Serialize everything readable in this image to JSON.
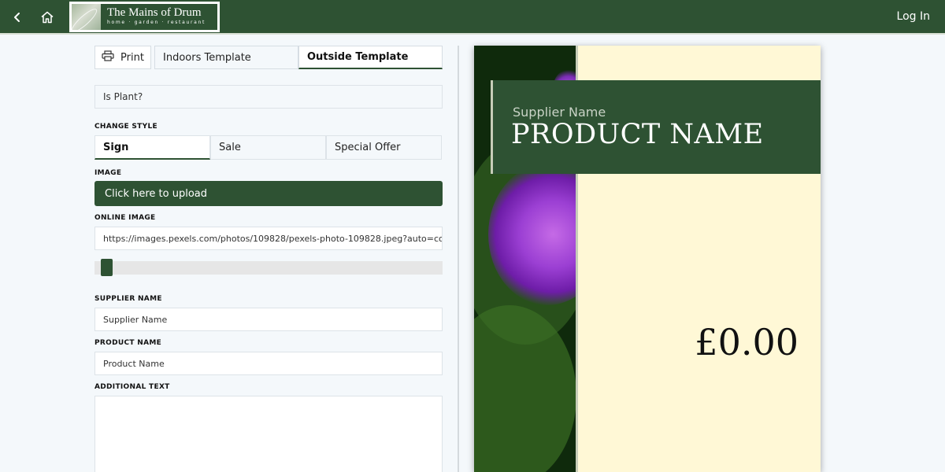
{
  "header": {
    "back_icon": "chevron-left-icon",
    "home_icon": "home-icon",
    "logo": {
      "title": "The Mains of Drum",
      "subtitle": "home · garden · restaurant"
    },
    "login_label": "Log In"
  },
  "toolbar": {
    "print_label": "Print",
    "print_icon": "printer-icon",
    "tabs": [
      {
        "label": "Indoors Template",
        "active": false
      },
      {
        "label": "Outside Template",
        "active": true
      }
    ]
  },
  "form": {
    "is_plant_label": "Is Plant?",
    "change_style_label": "CHANGE STYLE",
    "styles": [
      {
        "label": "Sign",
        "active": true
      },
      {
        "label": "Sale",
        "active": false
      },
      {
        "label": "Special Offer",
        "active": false
      }
    ],
    "image_label": "IMAGE",
    "upload_label": "Click here to upload",
    "online_image_label": "ONLINE IMAGE",
    "online_image_value": "https://images.pexels.com/photos/109828/pexels-photo-109828.jpeg?auto=co",
    "slider_value_fraction": 0.0,
    "supplier_name_label": "SUPPLIER NAME",
    "supplier_name_value": "Supplier Name",
    "product_name_label": "PRODUCT NAME",
    "product_name_value": "Product Name",
    "additional_text_label": "ADDITIONAL TEXT",
    "additional_text_value": ""
  },
  "preview": {
    "supplier_name": "Supplier Name",
    "product_name": "PRODUCT NAME",
    "price": "£0.00"
  },
  "colors": {
    "brand_green": "#2e5233",
    "sign_background": "#fff8d6",
    "page_background": "#f4f8fb"
  }
}
